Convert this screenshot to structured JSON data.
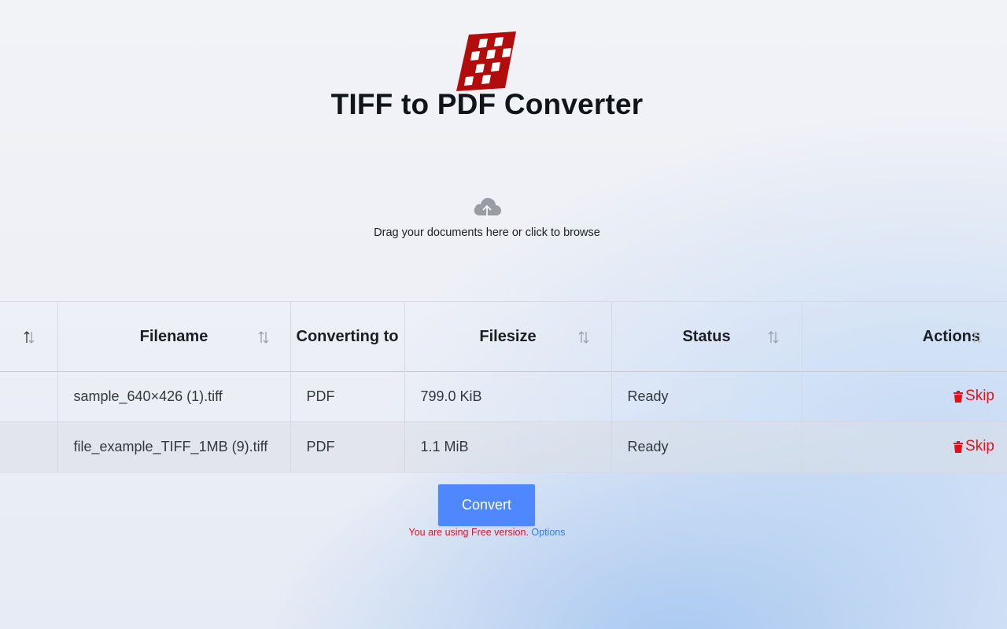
{
  "header": {
    "title": "TIFF to PDF Converter",
    "logo_icon": "checkered-tile-logo"
  },
  "dropzone": {
    "icon": "cloud-upload-icon",
    "hint": "Drag your documents here or click to browse"
  },
  "table": {
    "columns": [
      "",
      "Filename",
      "Converting to",
      "Filesize",
      "Status",
      "Actions"
    ],
    "rows": [
      {
        "filename": "sample_640×426 (1).tiff",
        "converting_to": "PDF",
        "filesize": "799.0 KiB",
        "status": "Ready",
        "action": "Skip"
      },
      {
        "filename": "file_example_TIFF_1MB (9).tiff",
        "converting_to": "PDF",
        "filesize": "1.1 MiB",
        "status": "Ready",
        "action": "Skip"
      }
    ]
  },
  "convert_button": {
    "label": "Convert"
  },
  "notice": {
    "text": "You are using Free version. ",
    "link": "Options"
  },
  "colors": {
    "accent": "#4f87ff",
    "danger": "#e0121b",
    "link": "#2f7de0",
    "logo": "#b30c0c"
  }
}
